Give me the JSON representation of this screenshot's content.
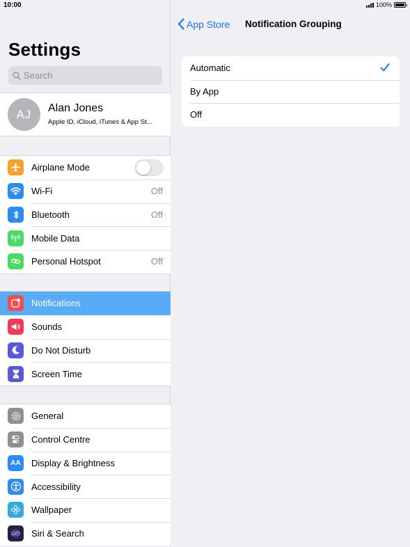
{
  "status_bar": {
    "time": "10:00",
    "battery": "100%"
  },
  "settings": {
    "title": "Settings",
    "search_placeholder": "Search",
    "profile": {
      "initials": "AJ",
      "name": "Alan Jones",
      "subtitle": "Apple ID, iCloud, iTunes & App St..."
    },
    "group1": [
      {
        "label": "Airplane Mode",
        "icon": "airplane-icon",
        "color": "#f7a030",
        "toggle": false
      },
      {
        "label": "Wi-Fi",
        "icon": "wifi-icon",
        "color": "#2d8cf0",
        "value": "Off"
      },
      {
        "label": "Bluetooth",
        "icon": "bluetooth-icon",
        "color": "#2d8cf0",
        "value": "Off"
      },
      {
        "label": "Mobile Data",
        "icon": "antenna-icon",
        "color": "#4cd964"
      },
      {
        "label": "Personal Hotspot",
        "icon": "hotspot-icon",
        "color": "#4cd964",
        "value": "Off"
      }
    ],
    "group2": [
      {
        "label": "Notifications",
        "icon": "notifications-icon",
        "color": "#f24e4e",
        "selected": true
      },
      {
        "label": "Sounds",
        "icon": "speaker-icon",
        "color": "#f2385c"
      },
      {
        "label": "Do Not Disturb",
        "icon": "moon-icon",
        "color": "#5a5ad6"
      },
      {
        "label": "Screen Time",
        "icon": "hourglass-icon",
        "color": "#5a5ad6"
      }
    ],
    "group3": [
      {
        "label": "General",
        "icon": "gear-icon",
        "color": "#8e8e93"
      },
      {
        "label": "Control Centre",
        "icon": "switches-icon",
        "color": "#8e8e93"
      },
      {
        "label": "Display & Brightness",
        "icon": "text-size-icon",
        "color": "#2d8cf0"
      },
      {
        "label": "Accessibility",
        "icon": "accessibility-icon",
        "color": "#2d8cf0"
      },
      {
        "label": "Wallpaper",
        "icon": "flower-icon",
        "color": "#35aadc"
      },
      {
        "label": "Siri & Search",
        "icon": "siri-icon",
        "color": "#222244"
      }
    ]
  },
  "detail": {
    "back_label": "App Store",
    "title": "Notification Grouping",
    "options": [
      {
        "label": "Automatic",
        "checked": true
      },
      {
        "label": "By App",
        "checked": false
      },
      {
        "label": "Off",
        "checked": false
      }
    ],
    "accent_color": "#1a73e8"
  }
}
